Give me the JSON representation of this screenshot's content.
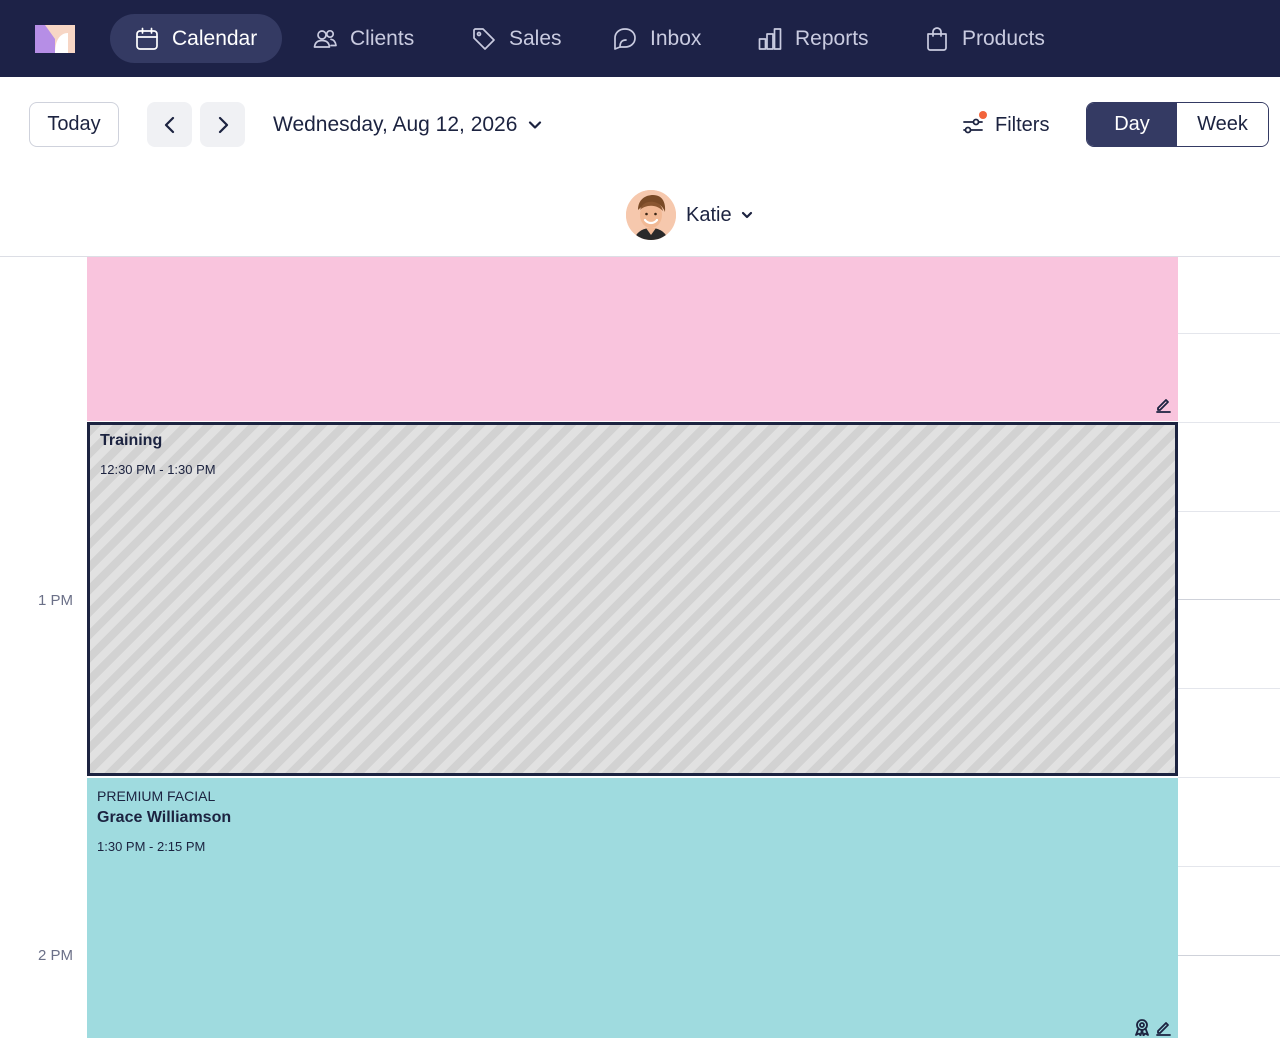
{
  "nav": {
    "items": [
      {
        "label": "Calendar",
        "icon": "calendar-icon",
        "active": true
      },
      {
        "label": "Clients",
        "icon": "users-icon",
        "active": false
      },
      {
        "label": "Sales",
        "icon": "tag-icon",
        "active": false
      },
      {
        "label": "Inbox",
        "icon": "chat-icon",
        "active": false
      },
      {
        "label": "Reports",
        "icon": "bar-chart-icon",
        "active": false
      },
      {
        "label": "Products",
        "icon": "shopping-bag-icon",
        "active": false
      }
    ]
  },
  "toolbar": {
    "today_label": "Today",
    "date_label": "Wednesday, Aug 12, 2026",
    "filters_label": "Filters",
    "view_day": "Day",
    "view_week": "Week",
    "active_view": "Day"
  },
  "staff": {
    "name": "Katie"
  },
  "time_labels": [
    "1 PM",
    "2 PM"
  ],
  "appointments": [
    {
      "id": "pink-block",
      "color": "#f9c4dd",
      "title": "",
      "service": "",
      "time": ""
    },
    {
      "id": "training",
      "title": "Training",
      "time": "12:30 PM - 1:30 PM"
    },
    {
      "id": "premium-facial",
      "color": "#9fdbdf",
      "service": "PREMIUM FACIAL",
      "title": "Grace Williamson",
      "time": "1:30 PM - 2:15 PM"
    }
  ],
  "colors": {
    "nav_bg": "#1d2247",
    "accent": "#343a63",
    "filter_dot": "#f2643c"
  }
}
